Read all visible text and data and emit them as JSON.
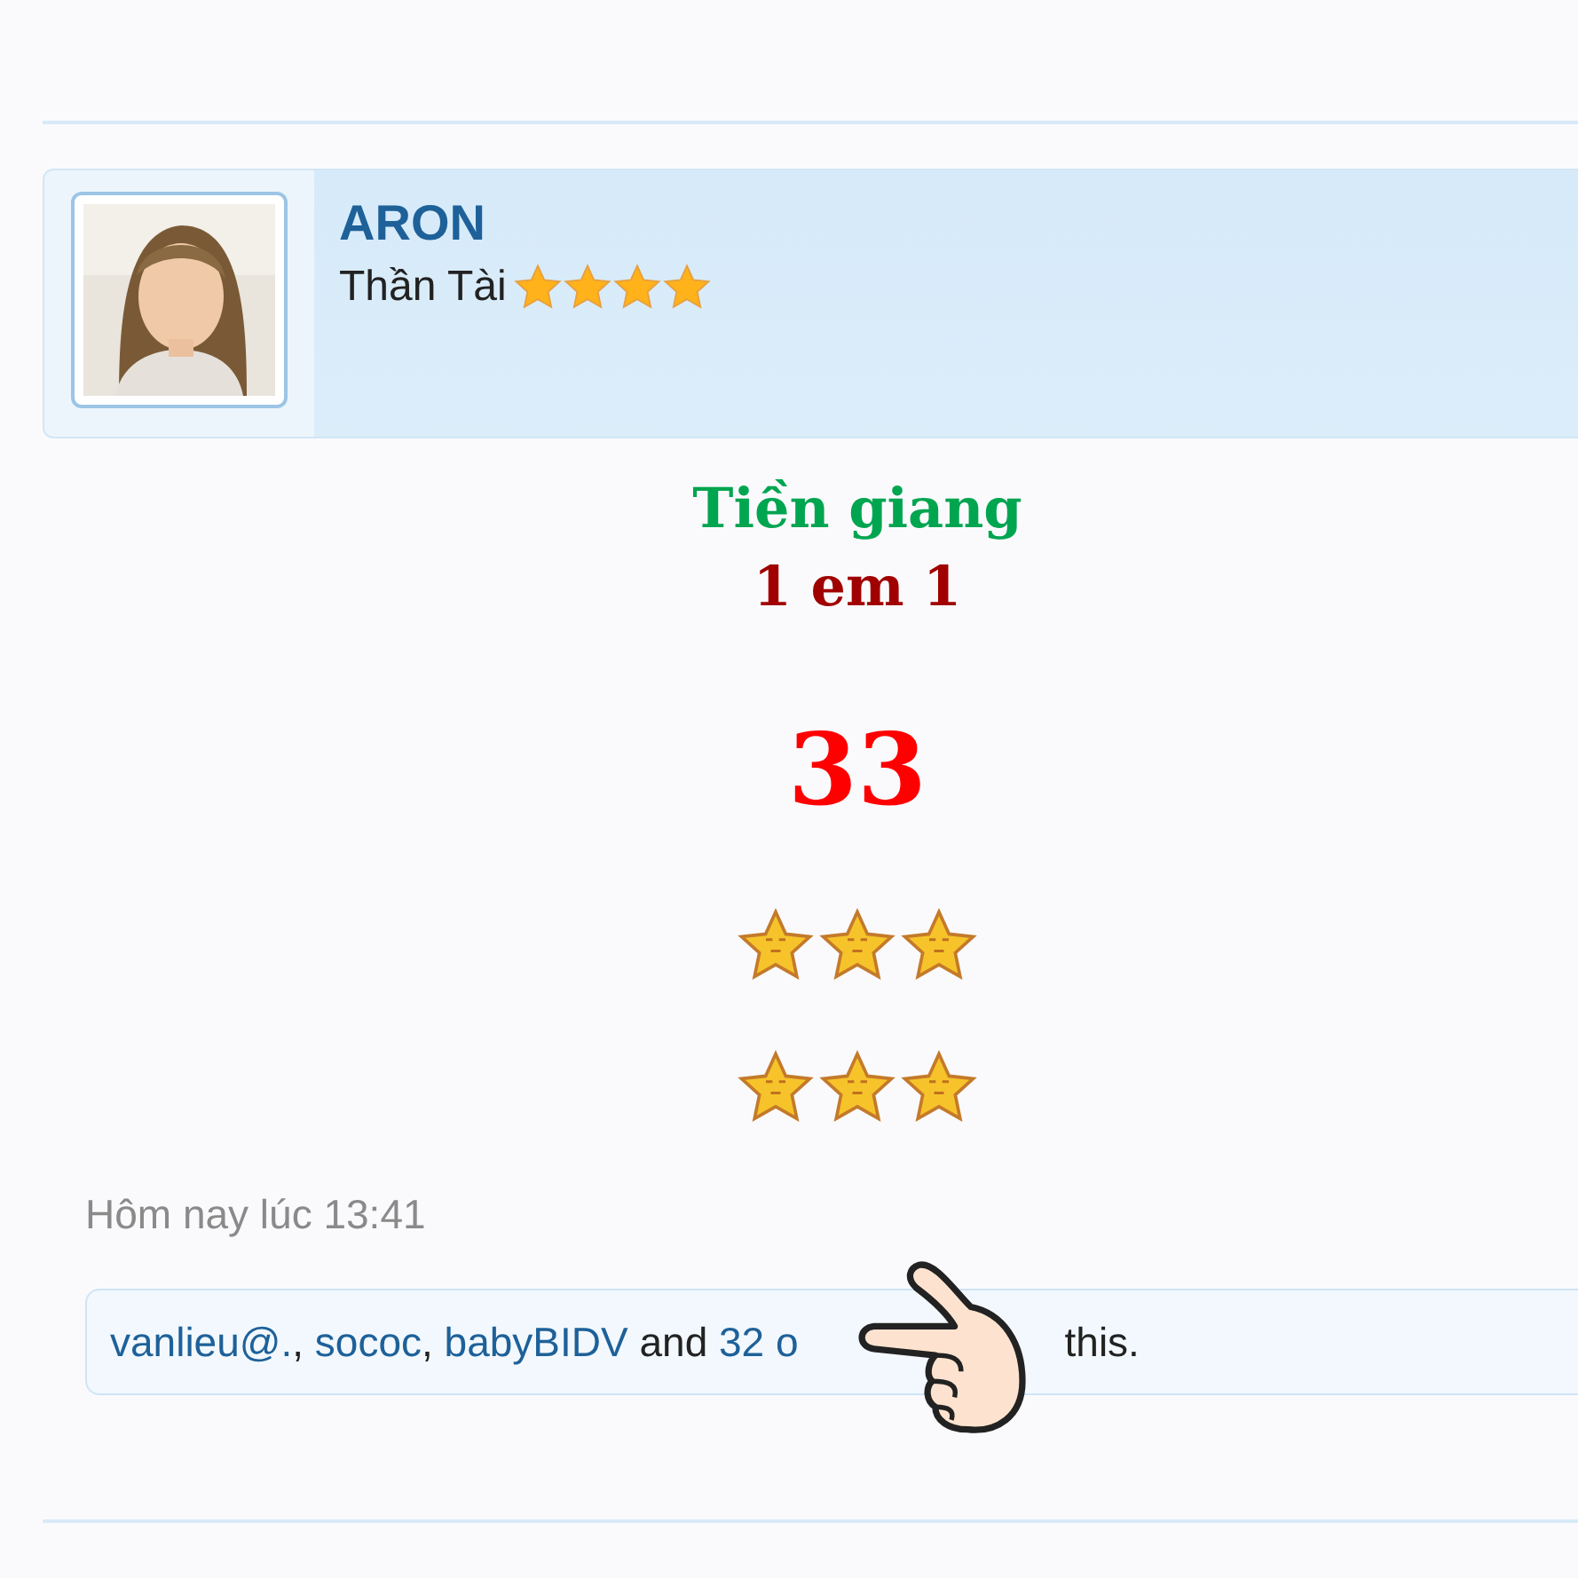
{
  "post": {
    "author": {
      "name": "ARON",
      "rank": "Thần Tài",
      "stars": 4
    },
    "body": [
      {
        "kind": "text",
        "text": "Tiền giang",
        "color": "#00a550"
      },
      {
        "kind": "text",
        "text": "1 em 1",
        "color": "#a00000"
      },
      {
        "kind": "number",
        "text": "33",
        "color": "#ff0000"
      },
      {
        "kind": "smilies",
        "stars": 3
      },
      {
        "kind": "smilies",
        "stars": 3
      }
    ],
    "time": "Hôm nay lúc 13:41",
    "likes": {
      "separator": ",",
      "users": [
        "vanlieu@.",
        "sococ",
        "babyBIDV"
      ],
      "joiner": "and",
      "others": "32 o",
      "tail": "this."
    }
  }
}
